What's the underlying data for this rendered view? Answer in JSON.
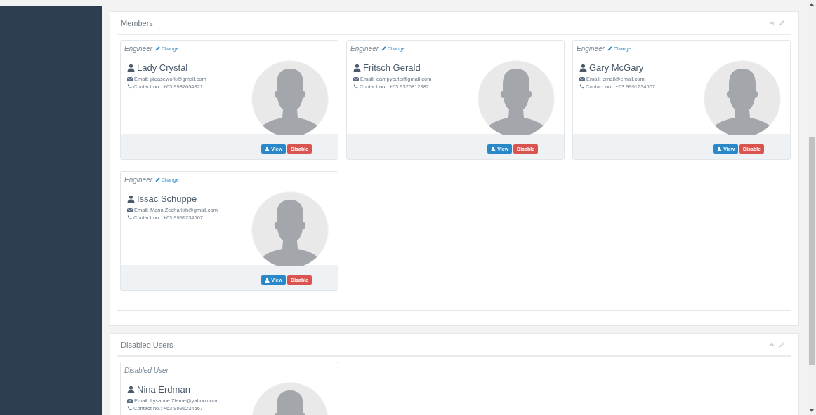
{
  "panels": [
    {
      "title": "Members",
      "cards": [
        {
          "role": "Engineer",
          "change_link": "Change",
          "name": "Lady Crystal",
          "email": "Email: pleasework@gmail.com",
          "contact": "Contact no.: +63 9987654321",
          "buttons": [
            {
              "label": "View",
              "kind": "view"
            },
            {
              "label": "Disable",
              "kind": "disable"
            }
          ]
        },
        {
          "role": "Engineer",
          "change_link": "Change",
          "name": "Fritsch Gerald",
          "email": "Email: dampycute@gmail.com",
          "contact": "Contact no.: +63 9326812882",
          "buttons": [
            {
              "label": "View",
              "kind": "view"
            },
            {
              "label": "Disable",
              "kind": "disable"
            }
          ]
        },
        {
          "role": "Engineer",
          "change_link": "Change",
          "name": "Gary McGary",
          "email": "Email: email@email.com",
          "contact": "Contact no.: +63 9991234567",
          "buttons": [
            {
              "label": "View",
              "kind": "view"
            },
            {
              "label": "Disable",
              "kind": "disable"
            }
          ]
        },
        {
          "role": "Engineer",
          "change_link": "Change",
          "name": "Issac Schuppe",
          "email": "Email: Mann.Zechariah@gmail.com",
          "contact": "Contact no.: +63 9991234567",
          "buttons": [
            {
              "label": "View",
              "kind": "view"
            },
            {
              "label": "Disable",
              "kind": "disable"
            }
          ]
        }
      ]
    },
    {
      "title": "Disabled Users",
      "cards": [
        {
          "role": "Disabled User",
          "name": "Nina Erdman",
          "email": "Email: Lysanne.Zieme@yahoo.com",
          "contact": "Contact no.: +63 9991234567"
        }
      ]
    }
  ]
}
